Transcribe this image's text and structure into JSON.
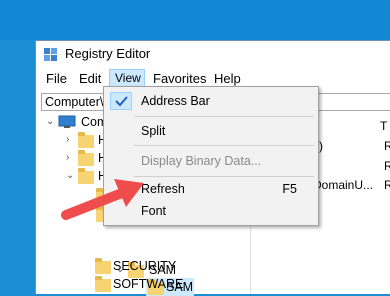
{
  "window": {
    "title": "Registry Editor"
  },
  "menubar": {
    "items": [
      "File",
      "Edit",
      "View",
      "Favorites",
      "Help"
    ]
  },
  "addressbar": {
    "value": "Computer\\"
  },
  "tree": {
    "root": "Comp",
    "hives": [
      "H",
      "H",
      "H"
    ],
    "sam_parent": "SAM",
    "sam_child": "SAM",
    "security": "SECURITY",
    "software": "SOFTWARE"
  },
  "right_pane": {
    "col_marker": "T",
    "row1": "lt)",
    "row2": "DomainU...",
    "edge": [
      "R",
      "R",
      "R"
    ]
  },
  "view_menu": {
    "items": [
      {
        "label": "Address Bar",
        "checked": true,
        "enabled": true,
        "shortcut": ""
      },
      {
        "label": "Split",
        "checked": false,
        "enabled": true,
        "shortcut": ""
      },
      {
        "label": "Display Binary Data...",
        "checked": false,
        "enabled": false,
        "shortcut": ""
      },
      {
        "label": "Refresh",
        "checked": false,
        "enabled": true,
        "shortcut": "F5"
      },
      {
        "label": "Font",
        "checked": false,
        "enabled": true,
        "shortcut": ""
      }
    ]
  },
  "colors": {
    "desktop": "#1a8fd6",
    "highlight": "#cce8ff",
    "folder": "#f7d471",
    "arrow": "#ef4d4d"
  },
  "icons": [
    "registry-editor-icon",
    "checkmark-icon",
    "computer-icon",
    "folder-icon",
    "chevron-right-icon",
    "chevron-down-icon",
    "annotation-arrow-icon"
  ]
}
